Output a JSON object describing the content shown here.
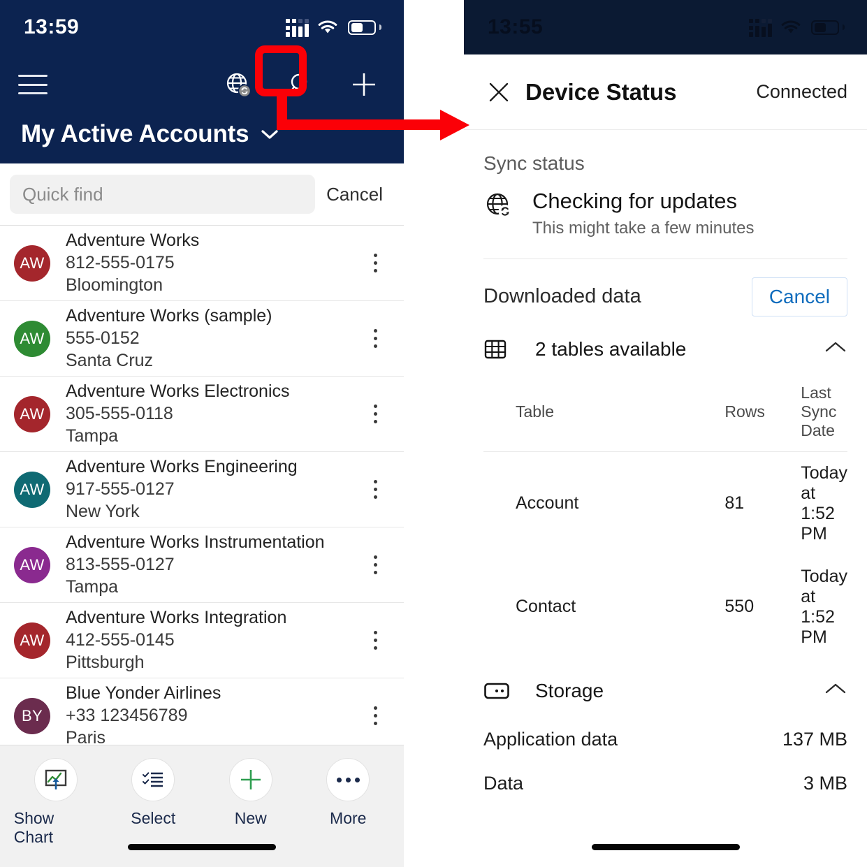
{
  "left_phone": {
    "status_bar": {
      "time": "13:59",
      "signal_icon": "cellular-signal-icon",
      "wifi_icon": "wifi-icon",
      "battery_icon": "battery-icon"
    },
    "app_bar": {
      "menu_icon": "hamburger-menu-icon",
      "sync_icon": "globe-sync-icon",
      "search_icon": "search-icon",
      "new_icon": "plus-icon",
      "view_title": "My Active Accounts",
      "view_chevron_icon": "chevron-down-icon"
    },
    "search": {
      "placeholder": "Quick find",
      "value": "",
      "cancel_label": "Cancel"
    },
    "accounts": [
      {
        "initials": "AW",
        "color": "#a4262c",
        "name": "Adventure Works",
        "phone": "812-555-0175",
        "city": "Bloomington"
      },
      {
        "initials": "AW",
        "color": "#2e8b33",
        "name": "Adventure Works (sample)",
        "phone": "555-0152",
        "city": "Santa Cruz"
      },
      {
        "initials": "AW",
        "color": "#a4262c",
        "name": "Adventure Works Electronics",
        "phone": "305-555-0118",
        "city": "Tampa"
      },
      {
        "initials": "AW",
        "color": "#0f6a73",
        "name": "Adventure Works Engineering",
        "phone": "917-555-0127",
        "city": "New York"
      },
      {
        "initials": "AW",
        "color": "#8a2a8f",
        "name": "Adventure Works Instrumentation",
        "phone": "813-555-0127",
        "city": "Tampa"
      },
      {
        "initials": "AW",
        "color": "#a4262c",
        "name": "Adventure Works Integration",
        "phone": "412-555-0145",
        "city": "Pittsburgh"
      },
      {
        "initials": "BY",
        "color": "#6b2c4e",
        "name": "Blue Yonder Airlines",
        "phone": "+33 123456789",
        "city": "Paris"
      }
    ],
    "row_menu_icon": "kebab-menu-icon",
    "command_bar": [
      {
        "label": "Show Chart",
        "icon": "show-chart-icon"
      },
      {
        "label": "Select",
        "icon": "checklist-icon"
      },
      {
        "label": "New",
        "icon": "plus-icon"
      },
      {
        "label": "More",
        "icon": "ellipsis-icon"
      }
    ]
  },
  "right_phone": {
    "status_bar": {
      "time": "13:55",
      "signal_icon": "cellular-signal-icon",
      "wifi_icon": "wifi-icon",
      "battery_icon": "battery-icon"
    },
    "header": {
      "close_icon": "close-icon",
      "title": "Device Status",
      "connection_status": "Connected"
    },
    "sync": {
      "section_label": "Sync status",
      "icon": "globe-sync-icon",
      "primary": "Checking for updates",
      "secondary": "This might take a few minutes"
    },
    "downloaded": {
      "title": "Downloaded data",
      "cancel_label": "Cancel",
      "tables_group": {
        "icon": "table-grid-icon",
        "title": "2 tables available",
        "collapse_icon": "chevron-up-icon",
        "columns": [
          "Table",
          "Rows",
          "Last Sync Date"
        ],
        "rows": [
          {
            "table": "Account",
            "rows": "81",
            "last_sync": "Today at 1:52 PM"
          },
          {
            "table": "Contact",
            "rows": "550",
            "last_sync": "Today at 1:52 PM"
          }
        ]
      },
      "storage_group": {
        "icon": "storage-device-icon",
        "title": "Storage",
        "collapse_icon": "chevron-up-icon",
        "items": [
          {
            "label": "Application data",
            "value": "137 MB"
          },
          {
            "label": "Data",
            "value": "3 MB"
          }
        ]
      }
    }
  },
  "annotation": {
    "highlight_target": "globe-sync-icon",
    "color": "#fb0007",
    "arrow_direction": "right"
  },
  "colors": {
    "app_bar_navy": "#0c2350",
    "accent_blue": "#0f6cbd",
    "accent_green": "#2e8b33",
    "annotation_red": "#fb0007"
  }
}
